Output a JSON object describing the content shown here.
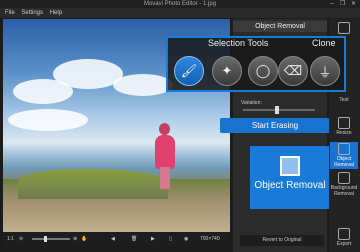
{
  "window": {
    "title": "Movavi Photo Editor - 1.jpg",
    "controls": "─ ❐ ✕"
  },
  "menu": {
    "file": "File",
    "settings": "Settings",
    "help": "Help"
  },
  "bottombar": {
    "zoom_label": "1:1",
    "dimensions": "700×740"
  },
  "panel": {
    "title": "Object Removal",
    "variation_label": "Variation:",
    "variation_value": 0.45,
    "start_erasing": "Start Erasing",
    "object_removal_big": "Object Removal",
    "revert": "Revert to Original"
  },
  "popup": {
    "selection_tools": "Selection Tools",
    "clone": "Clone",
    "tools": [
      {
        "icon": "brush-icon",
        "glyph": "🖌"
      },
      {
        "icon": "magic-wand-icon",
        "glyph": "✦"
      },
      {
        "icon": "lasso-icon",
        "glyph": "◯"
      },
      {
        "icon": "eraser-icon",
        "glyph": "⌫"
      },
      {
        "icon": "clone-stamp-icon",
        "glyph": "⏚"
      }
    ]
  },
  "rightbar": {
    "text": "Text",
    "resize": "Resize",
    "object_removal": "Object Removal",
    "background_removal": "Background Removal",
    "export": "Export"
  }
}
